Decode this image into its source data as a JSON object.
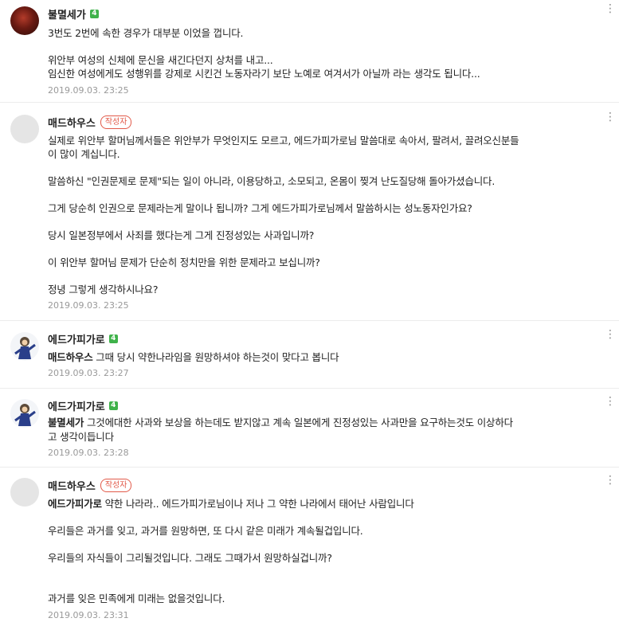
{
  "comments": [
    {
      "nickname": "불멸세가",
      "level": "4",
      "lines": [
        "3번도 2번에 속한 경우가 대부분 이었을 껍니다.",
        "위안부 여성의 신체에 문신을 새긴다던지 상처를 내고...",
        "임신한 여성에게도 성행위를 강제로 시킨건 노동자라기 보단 노예로 여겨서가 아닐까 라는 생각도 됩니다..."
      ],
      "date": "2019.09.03. 23:25"
    },
    {
      "nickname": "매드하우스",
      "author_badge": "작성자",
      "lines": [
        "실제로 위안부 할머님께서들은 위안부가 무엇인지도 모르고, 에드가피가로님 말씀대로 속아서, 팔려서, 끌려오신분들",
        "이 많이 계십니다.",
        "말씀하신 \"인권문제로 문제\"되는 일이 아니라, 이용당하고, 소모되고, 온몸이 찢겨 난도질당해 돌아가셨습니다.",
        "그게 당순히 인권으로 문제라는게 말이나 됩니까? 그게 에드가피가로님께서 말씀하시는 성노동자인가요?",
        "당시 일본정부에서 사죄를 했다는게 그게 진정성있는 사과입니까?",
        "이 위안부 할머님 문제가 단순히 정치만을 위한 문제라고 보십니까?",
        "정녕 그렇게 생각하시나요?"
      ],
      "date": "2019.09.03. 23:25"
    },
    {
      "nickname": "에드가피가로",
      "level": "4",
      "mention": "매드하우스",
      "lines": [
        "그때 당시 약한나라임을 원망하셔야 하는것이 맞다고 봅니다"
      ],
      "date": "2019.09.03. 23:27"
    },
    {
      "nickname": "에드가피가로",
      "level": "4",
      "mention": "불멸세가",
      "lines": [
        "그것에대한 사과와 보상을 하는데도 받지않고 계속 일본에게 진정성있는 사과만을 요구하는것도 이상하다",
        "고 생각이듭니다"
      ],
      "date": "2019.09.03. 23:28"
    },
    {
      "nickname": "매드하우스",
      "author_badge": "작성자",
      "mention": "에드가피가로",
      "lines": [
        "약한 나라라.. 에드가피가로님이나 저나 그 약한 나라에서 태어난 사람입니다",
        "우리들은 과거를 잊고, 과거를 원망하면, 또 다시 같은 미래가 계속될겁입니다.",
        "우리들의 자식들이 그리될것입니다. 그래도 그때가서 원망하실겁니까?",
        "과거를 잊은 민족에게 미래는 없을것입니다."
      ],
      "date": "2019.09.03. 23:31"
    }
  ]
}
